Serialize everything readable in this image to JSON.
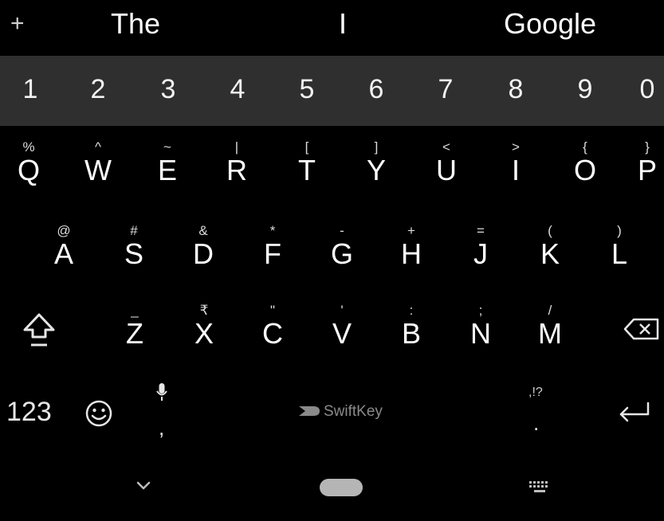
{
  "suggestions": {
    "add_label": "+",
    "items": [
      "The",
      "I",
      "Google"
    ]
  },
  "number_row": [
    "1",
    "2",
    "3",
    "4",
    "5",
    "6",
    "7",
    "8",
    "9",
    "0"
  ],
  "rows": [
    [
      {
        "key": "Q",
        "hint": "%"
      },
      {
        "key": "W",
        "hint": "^"
      },
      {
        "key": "E",
        "hint": "~"
      },
      {
        "key": "R",
        "hint": "|"
      },
      {
        "key": "T",
        "hint": "["
      },
      {
        "key": "Y",
        "hint": "]"
      },
      {
        "key": "U",
        "hint": "<"
      },
      {
        "key": "I",
        "hint": ">"
      },
      {
        "key": "O",
        "hint": "{"
      },
      {
        "key": "P",
        "hint": "}"
      }
    ],
    [
      {
        "key": "A",
        "hint": "@"
      },
      {
        "key": "S",
        "hint": "#"
      },
      {
        "key": "D",
        "hint": "&"
      },
      {
        "key": "F",
        "hint": "*"
      },
      {
        "key": "G",
        "hint": "-"
      },
      {
        "key": "H",
        "hint": "+"
      },
      {
        "key": "J",
        "hint": "="
      },
      {
        "key": "K",
        "hint": "("
      },
      {
        "key": "L",
        "hint": ")"
      }
    ],
    [
      {
        "key": "Z",
        "hint": "_"
      },
      {
        "key": "X",
        "hint": "₹"
      },
      {
        "key": "C",
        "hint": "\""
      },
      {
        "key": "V",
        "hint": "'"
      },
      {
        "key": "B",
        "hint": ":"
      },
      {
        "key": "N",
        "hint": ";"
      },
      {
        "key": "M",
        "hint": "/"
      }
    ]
  ],
  "bottom_row": {
    "numbers_label": "123",
    "comma_label": ",",
    "brand_label": "SwiftKey",
    "punct_hint": ",!?",
    "period_label": "."
  },
  "icons": {
    "shift": "shift-icon",
    "backspace": "backspace-icon",
    "emoji": "emoji-icon",
    "mic": "mic-icon",
    "enter": "enter-icon",
    "nav_back": "chevron-down-icon",
    "nav_home": "home-pill-icon",
    "nav_keyboard": "keyboard-icon"
  }
}
